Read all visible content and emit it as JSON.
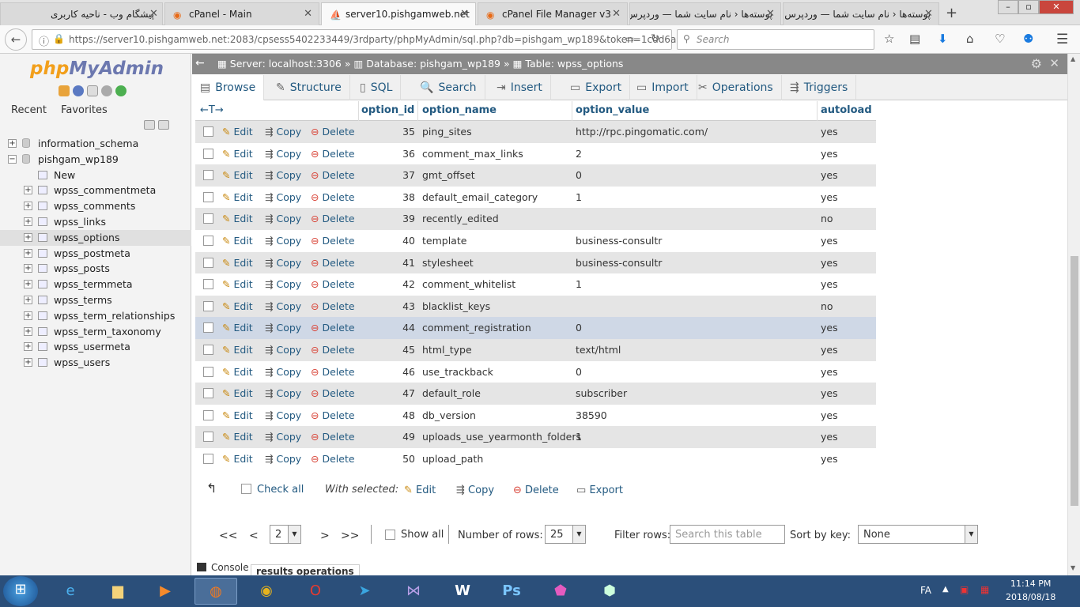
{
  "browser": {
    "tabs": [
      {
        "label": "پیشگام وب - ناحیه کاربری",
        "active": false
      },
      {
        "label": "cPanel - Main",
        "active": false
      },
      {
        "label": "server10.pishgamweb.net",
        "active": true
      },
      {
        "label": "cPanel File Manager v3",
        "active": false
      },
      {
        "label": "پوسته‌ها ‹ نام سایت شما — وردپرس",
        "active": false
      },
      {
        "label": "پوسته‌ها ‹ نام سایت شما — وردپرس",
        "active": false
      }
    ],
    "url_host": "https://server10.pishgamweb.net",
    "url_rest": ":2083/cpsess5402233449/3rdparty/phpMyAdmin/sql.php?db=pishgam_wp189&token=1cdd6a74",
    "search_placeholder": "Search"
  },
  "sidebar": {
    "logo_a": "php",
    "logo_b": "MyAdmin",
    "recent": "Recent",
    "favorites": "Favorites",
    "tree": [
      {
        "label": "information_schema",
        "level": 0,
        "type": "db"
      },
      {
        "label": "pishgam_wp189",
        "level": 0,
        "type": "db"
      },
      {
        "label": "New",
        "level": 1,
        "type": "new"
      },
      {
        "label": "wpss_commentmeta",
        "level": 1,
        "type": "table"
      },
      {
        "label": "wpss_comments",
        "level": 1,
        "type": "table"
      },
      {
        "label": "wpss_links",
        "level": 1,
        "type": "table"
      },
      {
        "label": "wpss_options",
        "level": 1,
        "type": "table",
        "selected": true
      },
      {
        "label": "wpss_postmeta",
        "level": 1,
        "type": "table"
      },
      {
        "label": "wpss_posts",
        "level": 1,
        "type": "table"
      },
      {
        "label": "wpss_termmeta",
        "level": 1,
        "type": "table"
      },
      {
        "label": "wpss_terms",
        "level": 1,
        "type": "table"
      },
      {
        "label": "wpss_term_relationships",
        "level": 1,
        "type": "table"
      },
      {
        "label": "wpss_term_taxonomy",
        "level": 1,
        "type": "table"
      },
      {
        "label": "wpss_usermeta",
        "level": 1,
        "type": "table"
      },
      {
        "label": "wpss_users",
        "level": 1,
        "type": "table"
      }
    ]
  },
  "breadcrumb": {
    "server": "Server: localhost:3306",
    "database": "Database: pishgam_wp189",
    "table": "Table: wpss_options"
  },
  "menu": [
    {
      "label": "Browse",
      "icon": "▤"
    },
    {
      "label": "Structure",
      "icon": "✎"
    },
    {
      "label": "SQL",
      "icon": "▯"
    },
    {
      "label": "Search",
      "icon": "🔍"
    },
    {
      "label": "Insert",
      "icon": "⇥"
    },
    {
      "label": "Export",
      "icon": "▭"
    },
    {
      "label": "Import",
      "icon": "▭"
    },
    {
      "label": "Operations",
      "icon": "✂"
    },
    {
      "label": "Triggers",
      "icon": "⇶"
    }
  ],
  "table": {
    "sort_arrows": "←T→",
    "headers": [
      "option_id",
      "option_name",
      "option_value",
      "autoload"
    ],
    "edit": "Edit",
    "copy": "Copy",
    "delete": "Delete",
    "rows": [
      {
        "id": "35",
        "name": "ping_sites",
        "value": "http://rpc.pingomatic.com/",
        "autoload": "yes"
      },
      {
        "id": "36",
        "name": "comment_max_links",
        "value": "2",
        "autoload": "yes"
      },
      {
        "id": "37",
        "name": "gmt_offset",
        "value": "0",
        "autoload": "yes"
      },
      {
        "id": "38",
        "name": "default_email_category",
        "value": "1",
        "autoload": "yes"
      },
      {
        "id": "39",
        "name": "recently_edited",
        "value": "",
        "autoload": "no"
      },
      {
        "id": "40",
        "name": "template",
        "value": "business-consultr",
        "autoload": "yes"
      },
      {
        "id": "41",
        "name": "stylesheet",
        "value": "business-consultr",
        "autoload": "yes"
      },
      {
        "id": "42",
        "name": "comment_whitelist",
        "value": "1",
        "autoload": "yes"
      },
      {
        "id": "43",
        "name": "blacklist_keys",
        "value": "",
        "autoload": "no"
      },
      {
        "id": "44",
        "name": "comment_registration",
        "value": "0",
        "autoload": "yes"
      },
      {
        "id": "45",
        "name": "html_type",
        "value": "text/html",
        "autoload": "yes"
      },
      {
        "id": "46",
        "name": "use_trackback",
        "value": "0",
        "autoload": "yes"
      },
      {
        "id": "47",
        "name": "default_role",
        "value": "subscriber",
        "autoload": "yes"
      },
      {
        "id": "48",
        "name": "db_version",
        "value": "38590",
        "autoload": "yes"
      },
      {
        "id": "49",
        "name": "uploads_use_yearmonth_folders",
        "value": "1",
        "autoload": "yes"
      },
      {
        "id": "50",
        "name": "upload_path",
        "value": "",
        "autoload": "yes"
      }
    ]
  },
  "bulk": {
    "check_all": "Check all",
    "with_selected": "With selected:",
    "edit": "Edit",
    "copy": "Copy",
    "delete": "Delete",
    "export": "Export"
  },
  "pager": {
    "first": "<<",
    "prev": "<",
    "page": "2",
    "next": ">",
    "last": ">>",
    "show_all": "Show all",
    "rows_label": "Number of rows:",
    "rows_value": "25",
    "filter_label": "Filter rows:",
    "filter_placeholder": "Search this table",
    "sort_label": "Sort by key:",
    "sort_value": "None"
  },
  "console": {
    "label": "Console",
    "tab": "results operations"
  },
  "taskbar": {
    "lang": "FA",
    "time": "11:14 PM",
    "date": "2018/08/18"
  }
}
